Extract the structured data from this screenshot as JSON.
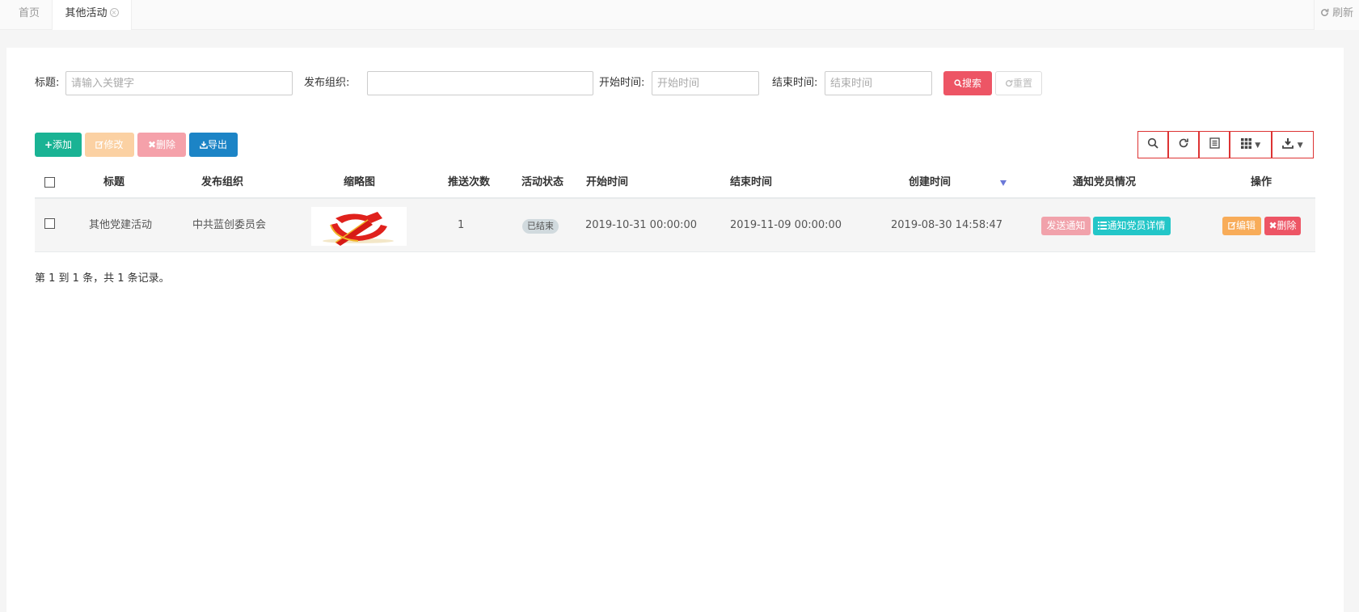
{
  "tabs": {
    "home_label": "首页",
    "active_label": "其他活动",
    "close_glyph": "×",
    "refresh_label": "刷新"
  },
  "search": {
    "title_label": "标题:",
    "title_placeholder": "请输入关键字",
    "org_label": "发布组织:",
    "org_value": "",
    "start_label": "开始时间:",
    "start_placeholder": "开始时间",
    "end_label": "结束时间:",
    "end_placeholder": "结束时间",
    "search_button": "搜索",
    "reset_button": "重置"
  },
  "toolbar": {
    "add": "添加",
    "edit": "修改",
    "delete": "删除",
    "export": "导出"
  },
  "table": {
    "columns": [
      "标题",
      "发布组织",
      "缩略图",
      "推送次数",
      "活动状态",
      "开始时间",
      "结束时间",
      "创建时间",
      "通知党员情况",
      "操作"
    ],
    "rows": [
      {
        "title": "其他党建活动",
        "org": "中共蓝创委员会",
        "push_count": "1",
        "status": "已结束",
        "start": "2019-10-31 00:00:00",
        "end": "2019-11-09 00:00:00",
        "created": "2019-08-30 14:58:47",
        "notify_button": "发送通知",
        "detail_button": "通知党员详情",
        "edit_button": "编辑",
        "delete_button": "删除"
      }
    ]
  },
  "pagination": {
    "summary": "第 1 到 1 条，共 1 条记录。"
  },
  "colors": {
    "primary": "#1ab394",
    "danger": "#ed5565",
    "warning": "#f8ac59",
    "info": "#23c6c8",
    "blue": "#1c84c6"
  }
}
